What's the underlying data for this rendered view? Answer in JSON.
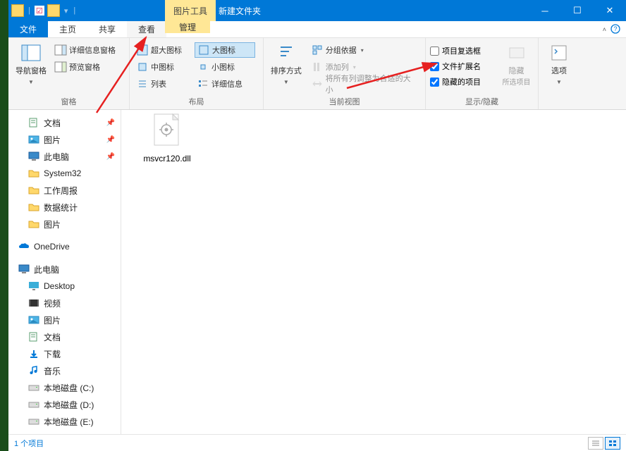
{
  "title": "新建文件夹",
  "contextTab": "图片工具",
  "tabs": {
    "file": "文件",
    "home": "主页",
    "share": "共享",
    "view": "查看",
    "manage": "管理"
  },
  "ribbon": {
    "panes": {
      "navPane": "导航窗格",
      "detailsPane": "详细信息窗格",
      "previewPane": "预览窗格",
      "groupLabel": "窗格"
    },
    "layout": {
      "extraLarge": "超大图标",
      "large": "大图标",
      "medium": "中图标",
      "small": "小图标",
      "list": "列表",
      "details": "详细信息",
      "groupLabel": "布局"
    },
    "currentView": {
      "sortBy": "排序方式",
      "groupBy": "分组依据",
      "addColumns": "添加列",
      "sizeAll": "将所有列调整为合适的大小",
      "groupLabel": "当前视图"
    },
    "showHide": {
      "itemCheckboxes": "项目复选框",
      "fileExt": "文件扩展名",
      "hiddenItems": "隐藏的项目",
      "hideSelected": "隐藏",
      "hideSelectedSub": "所选项目",
      "groupLabel": "显示/隐藏",
      "checked": {
        "itemCheckboxes": false,
        "fileExt": true,
        "hiddenItems": true
      }
    },
    "options": {
      "label": "选项"
    }
  },
  "nav": {
    "quick": [
      {
        "label": "文档",
        "icon": "doc",
        "pinned": true
      },
      {
        "label": "图片",
        "icon": "pic",
        "pinned": true
      },
      {
        "label": "此电脑",
        "icon": "pc",
        "pinned": true
      },
      {
        "label": "System32",
        "icon": "folder"
      },
      {
        "label": "工作周报",
        "icon": "folder"
      },
      {
        "label": "数据统计",
        "icon": "folder"
      },
      {
        "label": "图片",
        "icon": "folder"
      }
    ],
    "onedrive": "OneDrive",
    "thispc": "此电脑",
    "pcItems": [
      {
        "label": "Desktop",
        "icon": "desktop"
      },
      {
        "label": "视频",
        "icon": "video"
      },
      {
        "label": "图片",
        "icon": "pic"
      },
      {
        "label": "文档",
        "icon": "doc"
      },
      {
        "label": "下载",
        "icon": "download"
      },
      {
        "label": "音乐",
        "icon": "music"
      },
      {
        "label": "本地磁盘 (C:)",
        "icon": "disk"
      },
      {
        "label": "本地磁盘 (D:)",
        "icon": "disk"
      },
      {
        "label": "本地磁盘 (E:)",
        "icon": "disk"
      }
    ]
  },
  "files": [
    {
      "name": "msvcr120.dll"
    }
  ],
  "status": "1 个项目"
}
